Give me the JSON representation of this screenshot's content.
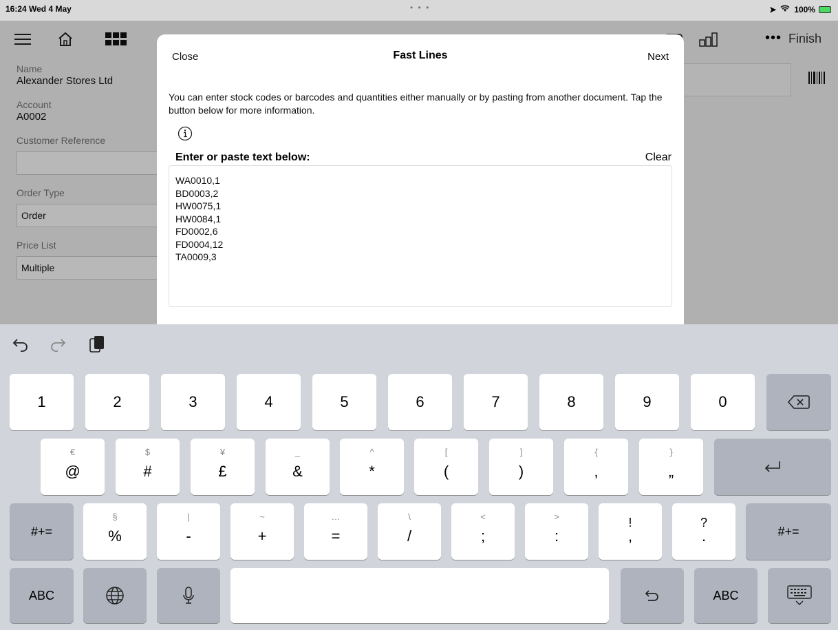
{
  "status_bar": {
    "time": "16:24  Wed 4 May",
    "battery": "100%"
  },
  "toolbar": {
    "finish_label": "Finish"
  },
  "form": {
    "name_label": "Name",
    "name_value": "Alexander Stores Ltd",
    "account_label": "Account",
    "account_value": "A0002",
    "cust_ref_label": "Customer Reference",
    "cust_ref_value": "",
    "order_type_label": "Order Type",
    "order_type_value": "Order",
    "price_list_label": "Price List",
    "price_list_value": "Multiple"
  },
  "modal": {
    "close_label": "Close",
    "title": "Fast Lines",
    "next_label": "Next",
    "description": "You can enter stock codes or barcodes and quantities either manually or by pasting from another document. Tap the button below for more information.",
    "prompt": "Enter or paste text below:",
    "clear_label": "Clear",
    "text": "WA0010,1\nBD0003,2\nHW0075,1\nHW0084,1\nFD0002,6\nFD0004,12\nTA0009,3"
  },
  "keyboard": {
    "row1": [
      "1",
      "2",
      "3",
      "4",
      "5",
      "6",
      "7",
      "8",
      "9",
      "0"
    ],
    "row2": [
      {
        "top": "€",
        "main": "@"
      },
      {
        "top": "$",
        "main": "#"
      },
      {
        "top": "¥",
        "main": "£"
      },
      {
        "top": "_",
        "main": "&"
      },
      {
        "top": "^",
        "main": "*"
      },
      {
        "top": "[",
        "main": "("
      },
      {
        "top": "]",
        "main": ")"
      },
      {
        "top": "{",
        "main": "‚"
      },
      {
        "top": "}",
        "main": "„"
      }
    ],
    "row3": [
      {
        "top": "§",
        "main": "%"
      },
      {
        "top": "|",
        "main": "-"
      },
      {
        "top": "~",
        "main": "+"
      },
      {
        "top": "…",
        "main": "="
      },
      {
        "top": "\\",
        "main": "/"
      },
      {
        "top": "<",
        "main": ";"
      },
      {
        "top": ">",
        "main": ":"
      },
      {
        "top": "!",
        "main": ","
      },
      {
        "top": "?",
        "main": "."
      }
    ],
    "shift_label": "#+=",
    "abc_label": "ABC"
  }
}
